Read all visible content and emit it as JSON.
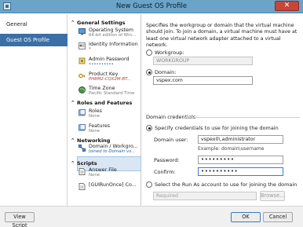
{
  "window": {
    "title": "New Guest OS Profile",
    "close_glyph": "✕"
  },
  "left_nav": {
    "items": [
      {
        "label": "General"
      },
      {
        "label": "Guest OS Profile"
      }
    ]
  },
  "settings_tree": {
    "general_settings": {
      "title": "General Settings",
      "items": [
        {
          "label": "Operating System",
          "sub": "64-bit edition of Win...",
          "icon": "operating-system-icon"
        },
        {
          "label": "Identity Information",
          "sub": "*",
          "icon": "identity-icon"
        },
        {
          "label": "Admin Password",
          "sub": "••••••••••",
          "icon": "admin-password-icon"
        },
        {
          "label": "Product Key",
          "sub": "PH8M2-CQX2M-BT...",
          "icon": "product-key-icon"
        },
        {
          "label": "Time Zone",
          "sub": "Pacific Standard Time",
          "icon": "time-zone-icon"
        }
      ]
    },
    "roles_features": {
      "title": "Roles and Features",
      "items": [
        {
          "label": "Roles",
          "sub": "None",
          "icon": "roles-icon"
        },
        {
          "label": "Features",
          "sub": "None",
          "icon": "features-icon"
        }
      ]
    },
    "networking": {
      "title": "Networking",
      "items": [
        {
          "label": "Domain / Workgro...",
          "sub": "Joined to Domain vs...",
          "icon": "domain-icon"
        }
      ]
    },
    "scripts": {
      "title": "Scripts",
      "items": [
        {
          "label": "Answer File",
          "sub": "None",
          "icon": "answer-file-icon"
        },
        {
          "label": "[GUIRunOnce] Co...",
          "sub": "",
          "icon": "guirunonce-icon"
        }
      ]
    }
  },
  "panel": {
    "description": "Specifies the workgroup or domain that the virtual machine should join.  To join a domain, a virtual machine must have at least one virtual network adapter attached to a virtual network.",
    "workgroup_label": "Workgroup:",
    "workgroup_value": "WORKGROUP",
    "domain_label": "Domain:",
    "domain_value": "vspex.com",
    "credentials_group": "Domain credentials",
    "specify_label": "Specify credentials to use for joining the domain",
    "domain_user_label": "Domain user:",
    "domain_user_value": "vspex0\\.administrator",
    "example_hint": "Example: domain\\username",
    "password_label": "Password:",
    "password_value": "•••••••••",
    "confirm_label": "Confirm:",
    "confirm_value": "••••••••••",
    "runas_label": "Select the Run As account to use for joining the domain",
    "required_placeholder": "Required",
    "browse_label": "Browse..."
  },
  "footer": {
    "view_script": "View Script",
    "ok": "OK",
    "cancel": "Cancel"
  }
}
